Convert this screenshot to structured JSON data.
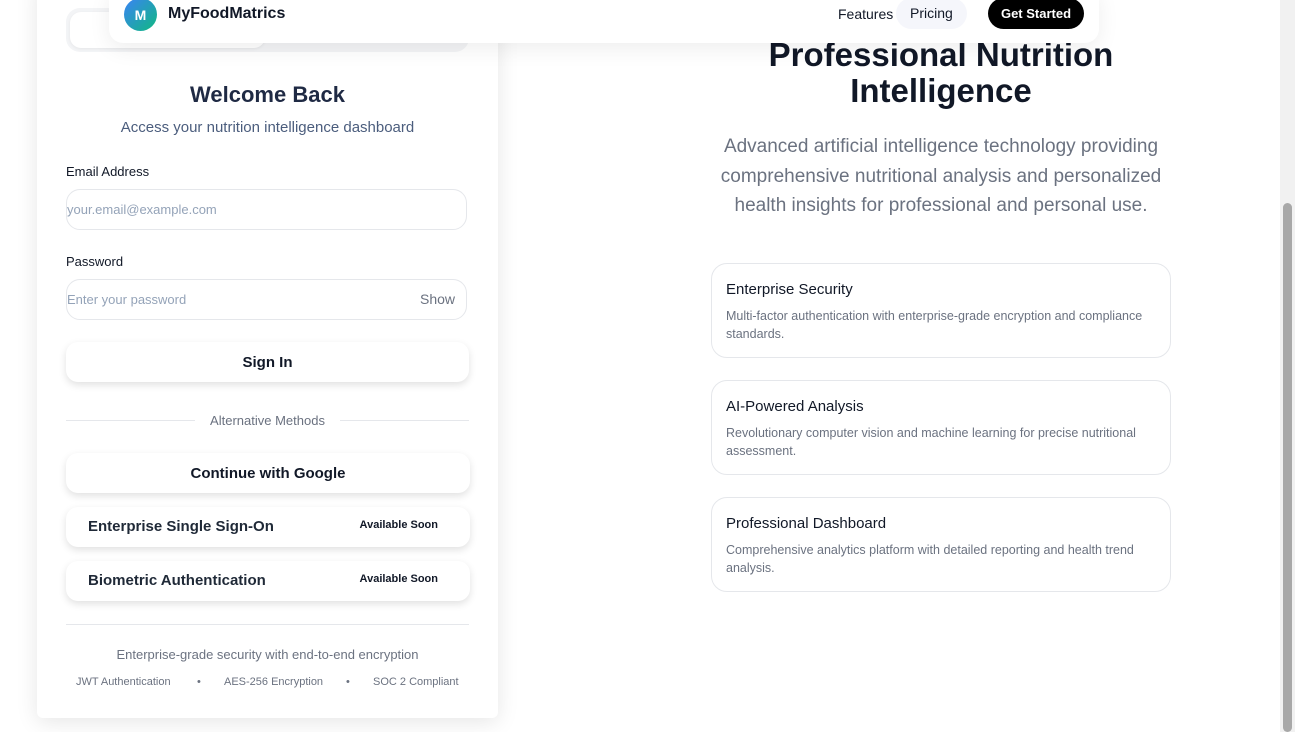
{
  "nav": {
    "logo_letter": "M",
    "brand": "MyFoodMatrics",
    "links": {
      "features": "Features",
      "pricing": "Pricing"
    },
    "cta": "Get Started"
  },
  "login": {
    "title": "Welcome Back",
    "subtitle": "Access your nutrition intelligence dashboard",
    "email_label": "Email Address",
    "email_placeholder": "your.email@example.com",
    "password_label": "Password",
    "password_placeholder": "Enter your password",
    "show_label": "Show",
    "signin_label": "Sign In",
    "divider_text": "Alternative Methods",
    "google_label": "Continue with Google",
    "alt_methods": [
      {
        "label": "Enterprise Single Sign-On",
        "badge": "Available Soon"
      },
      {
        "label": "Biometric Authentication",
        "badge": "Available Soon"
      }
    ],
    "security_text": "Enterprise-grade security with end-to-end encryption",
    "security_tags": [
      "JWT Authentication",
      "AES-256 Encryption",
      "SOC 2 Compliant"
    ],
    "separator": "•"
  },
  "hero": {
    "title": "Professional Nutrition Intelligence",
    "subtitle": "Advanced artificial intelligence technology providing comprehensive nutritional analysis and personalized health insights for professional and personal use."
  },
  "features": [
    {
      "title": "Enterprise Security",
      "description": "Multi-factor authentication with enterprise-grade encryption and compliance standards."
    },
    {
      "title": "AI-Powered Analysis",
      "description": "Revolutionary computer vision and machine learning for precise nutritional assessment."
    },
    {
      "title": "Professional Dashboard",
      "description": "Comprehensive analytics platform with detailed reporting and health trend analysis."
    }
  ],
  "colors": {
    "cta_bg": "#000000",
    "logo_gradient_start": "#3b82f6",
    "logo_gradient_end": "#10b981",
    "title": "#1f2a44",
    "muted": "#6b7280"
  }
}
